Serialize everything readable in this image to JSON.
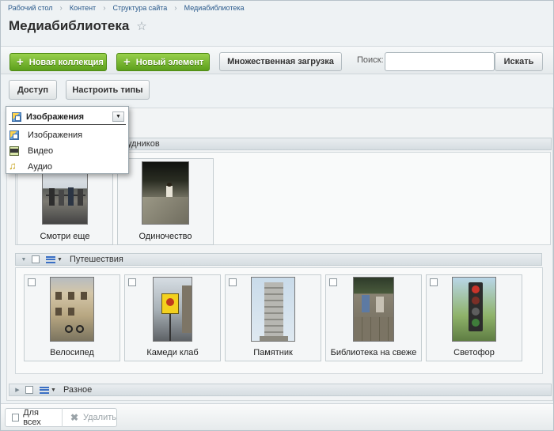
{
  "breadcrumb": [
    "Рабочий стол",
    "Контент",
    "Структура сайта",
    "Медиабиблиотека"
  ],
  "page_title": "Медиабиблиотека",
  "toolbar": {
    "new_collection": "Новая коллекция",
    "new_element": "Новый элемент",
    "multi_upload": "Множественная загрузка",
    "search_label": "Поиск:",
    "search_value": "",
    "search_button": "Искать"
  },
  "toolbar2": {
    "access": "Доступ",
    "configure_types": "Настроить типы"
  },
  "type_dropdown": {
    "selected": "Изображения",
    "options": [
      {
        "label": "Изображения",
        "icon": "images-icon"
      },
      {
        "label": "Видео",
        "icon": "video-icon"
      },
      {
        "label": "Аудио",
        "icon": "audio-icon"
      }
    ]
  },
  "collections": [
    {
      "title_visible": "рудников",
      "items": [
        {
          "label": "Смотри еще",
          "thumb": "people-at-railing-photo"
        },
        {
          "label": "Одиночество",
          "thumb": "person-on-rock-photo"
        }
      ]
    },
    {
      "title": "Путешествия",
      "items": [
        {
          "label": "Велосипед",
          "thumb": "bicycle-building-photo"
        },
        {
          "label": "Камеди клаб",
          "thumb": "street-sign-photo"
        },
        {
          "label": "Памятник",
          "thumb": "monument-photo"
        },
        {
          "label": "Библиотека на свеже",
          "thumb": "wall-people-photo"
        },
        {
          "label": "Светофор",
          "thumb": "traffic-light-photo"
        }
      ]
    },
    {
      "title": "Разное",
      "items": []
    }
  ],
  "footer": {
    "for_all": "Для всех",
    "delete": "Удалить"
  }
}
